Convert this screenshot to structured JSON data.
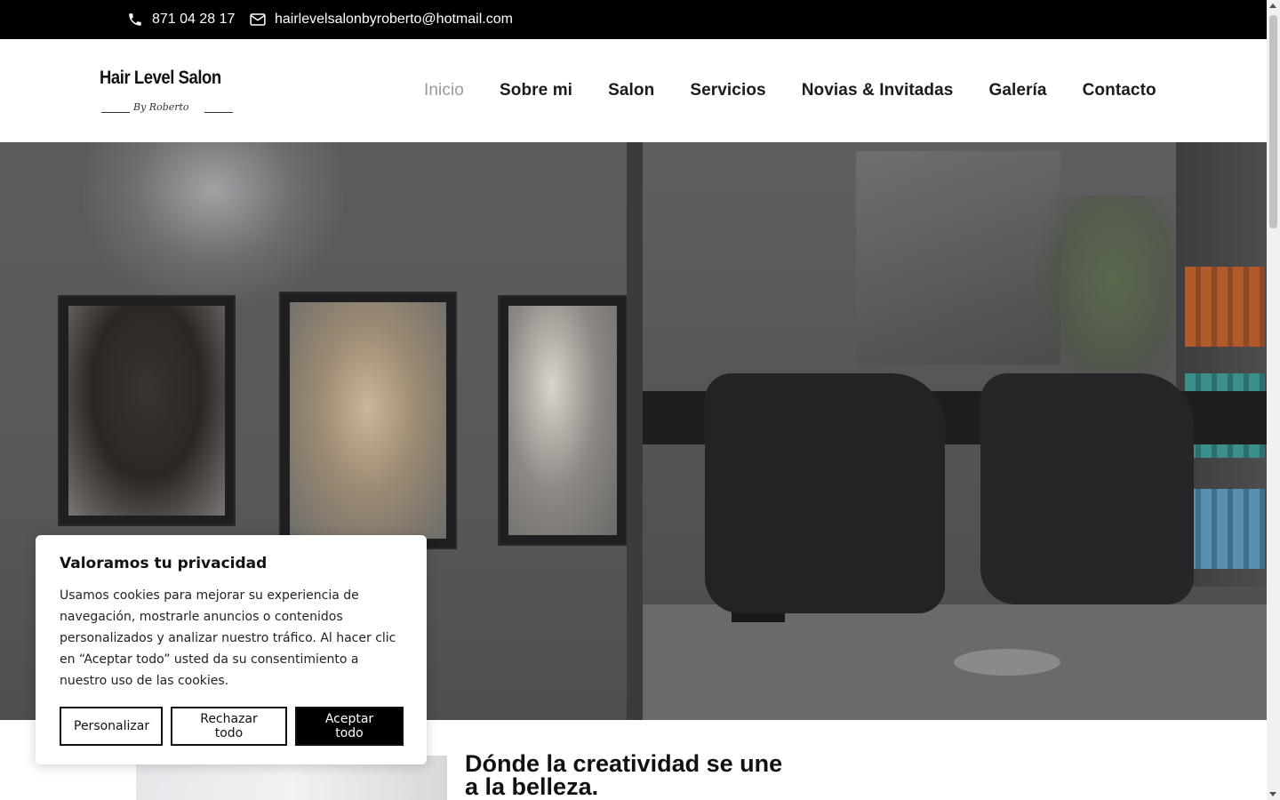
{
  "topbar": {
    "phone": "871 04 28 17",
    "email": "hairlevelsalonbyroberto@hotmail.com"
  },
  "logo": {
    "title": "Hair Level Salon",
    "subtitle": "By Roberto"
  },
  "nav": {
    "items": [
      {
        "label": "Inicio"
      },
      {
        "label": "Sobre mi"
      },
      {
        "label": "Salon"
      },
      {
        "label": "Servicios"
      },
      {
        "label": "Novias & Invitadas"
      },
      {
        "label": "Galería"
      },
      {
        "label": "Contacto"
      }
    ]
  },
  "section": {
    "headline": "Dónde la creatividad se une a la belleza."
  },
  "cookie": {
    "title": "Valoramos tu privacidad",
    "text": "Usamos cookies para mejorar su experiencia de navegación, mostrarle anuncios o contenidos personalizados y analizar nuestro tráfico. Al hacer clic en “Aceptar todo” usted da su consentimiento a nuestro uso de las cookies.",
    "customize_label": "Personalizar",
    "reject_label": "Rechazar todo",
    "accept_label": "Aceptar todo"
  },
  "colors": {
    "topbar_bg": "#000000",
    "nav_active": "#9a9a9a",
    "nav_text": "#1b1b1b",
    "accept_bg": "#000000"
  },
  "icons": {
    "phone": "phone-icon",
    "email": "envelope-icon"
  }
}
